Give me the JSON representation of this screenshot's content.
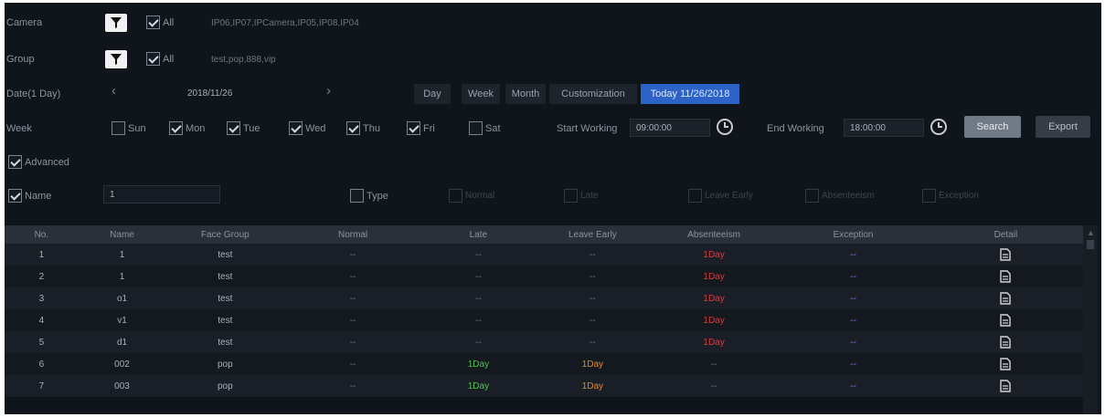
{
  "camera": {
    "label": "Camera",
    "all_label": "All",
    "value": "IP06,IP07,IPCamera,IP05,IP08,IP04"
  },
  "group": {
    "label": "Group",
    "all_label": "All",
    "value": "test,pop,888,vip"
  },
  "date": {
    "label": "Date(1 Day)",
    "value": "2018/11/26",
    "modes": [
      "Day",
      "Week",
      "Month",
      "Customization"
    ],
    "today_label": "Today 11/26/2018"
  },
  "week": {
    "label": "Week",
    "days": [
      {
        "label": "Sun",
        "checked": false
      },
      {
        "label": "Mon",
        "checked": true
      },
      {
        "label": "Tue",
        "checked": true
      },
      {
        "label": "Wed",
        "checked": true
      },
      {
        "label": "Thu",
        "checked": true
      },
      {
        "label": "Fri",
        "checked": true
      },
      {
        "label": "Sat",
        "checked": false
      }
    ],
    "start_label": "Start Working",
    "start_value": "09:00:00",
    "end_label": "End Working",
    "end_value": "18:00:00",
    "search_label": "Search",
    "export_label": "Export"
  },
  "advanced": {
    "label": "Advanced",
    "checked": true
  },
  "filters": {
    "name_label": "Name",
    "name_checked": true,
    "name_value": "1",
    "type_label": "Type",
    "type_checked": false,
    "types": [
      "Normal",
      "Late",
      "Leave Early",
      "Absenteeism",
      "Exception"
    ]
  },
  "table": {
    "headers": [
      "No.",
      "Name",
      "Face Group",
      "Normal",
      "Late",
      "Leave Early",
      "Absenteeism",
      "Exception",
      "Detail"
    ],
    "rows": [
      {
        "no": "1",
        "name": "1",
        "group": "test",
        "normal": "--",
        "late": "--",
        "leave_early": "--",
        "absent": "1Day",
        "exception": "--"
      },
      {
        "no": "2",
        "name": "1",
        "group": "test",
        "normal": "--",
        "late": "--",
        "leave_early": "--",
        "absent": "1Day",
        "exception": "--"
      },
      {
        "no": "3",
        "name": "o1",
        "group": "test",
        "normal": "--",
        "late": "--",
        "leave_early": "--",
        "absent": "1Day",
        "exception": "--"
      },
      {
        "no": "4",
        "name": "v1",
        "group": "test",
        "normal": "--",
        "late": "--",
        "leave_early": "--",
        "absent": "1Day",
        "exception": "--"
      },
      {
        "no": "5",
        "name": "d1",
        "group": "test",
        "normal": "--",
        "late": "--",
        "leave_early": "--",
        "absent": "1Day",
        "exception": "--"
      },
      {
        "no": "6",
        "name": "002",
        "group": "pop",
        "normal": "--",
        "late": "1Day",
        "leave_early": "1Day",
        "absent": "--",
        "exception": "--"
      },
      {
        "no": "7",
        "name": "003",
        "group": "pop",
        "normal": "--",
        "late": "1Day",
        "leave_early": "1Day",
        "absent": "--",
        "exception": "--"
      }
    ]
  },
  "colors": {
    "background": "#10141b",
    "accent": "#2d63c6",
    "late_green": "#49c24a",
    "leave_early_orange": "#e08a2a",
    "absent_red": "#d83c3c",
    "exception_purple": "#8a72e6"
  },
  "icons": [
    "filter-icon",
    "clock-icon",
    "document-icon",
    "chevron-left-icon",
    "chevron-right-icon"
  ]
}
